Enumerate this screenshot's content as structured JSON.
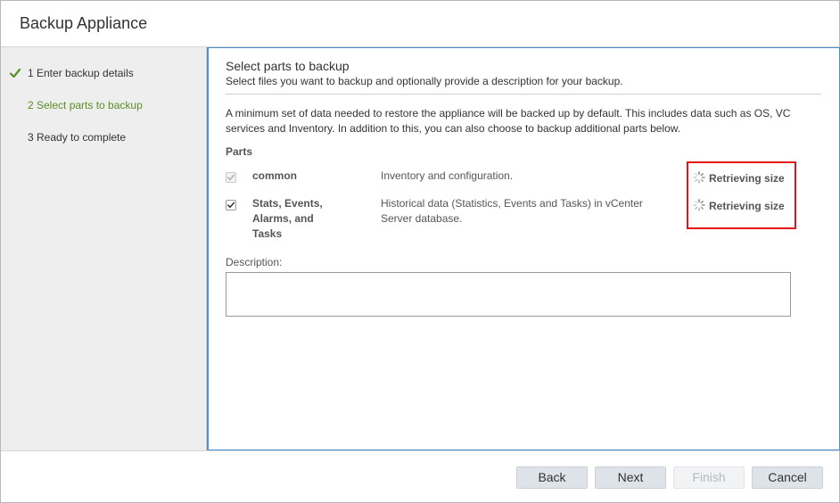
{
  "dialog": {
    "title": "Backup Appliance"
  },
  "steps": [
    {
      "label": "1 Enter backup details",
      "state": "completed"
    },
    {
      "label": "2 Select parts to backup",
      "state": "active"
    },
    {
      "label": "3 Ready to complete",
      "state": "pending"
    }
  ],
  "page": {
    "title": "Select parts to backup",
    "subtitle": "Select files you want to backup and optionally provide a description for your backup.",
    "info": "A minimum set of data needed to restore the appliance will be backed up by default. This includes data such as OS, VC services and Inventory. In addition to this, you can also choose to backup additional parts below.",
    "parts_label": "Parts",
    "parts": [
      {
        "name": "common",
        "description": "Inventory and configuration.",
        "size": "Retrieving size",
        "checked": true,
        "disabled": true
      },
      {
        "name": "Stats, Events, Alarms, and Tasks",
        "description": "Historical data (Statistics, Events and Tasks) in vCenter Server database.",
        "size": "Retrieving size",
        "checked": true,
        "disabled": false
      }
    ],
    "description_label": "Description:",
    "description_value": ""
  },
  "footer": {
    "back_label": "Back",
    "next_label": "Next",
    "finish_label": "Finish",
    "cancel_label": "Cancel"
  },
  "colors": {
    "accent_green": "#5a8d26",
    "highlight_red": "#e3121b",
    "focus_blue": "#4a90d0"
  },
  "icons": {
    "step_completed": "checkmark-icon",
    "loading": "spinner-icon",
    "checkbox": "checkbox-checked-icon"
  }
}
